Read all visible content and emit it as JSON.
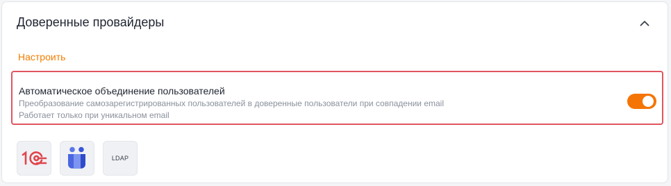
{
  "section": {
    "title": "Доверенные провайдеры",
    "collapse_icon": "chevron-up-icon"
  },
  "configure_link": "Настроить",
  "auto_merge": {
    "title": "Автоматическое объединение пользователей",
    "description_line1": "Преобразование самозарегистрированных пользователей в доверенные пользователи при совпадении email",
    "description_line2": "Работает только при уникальном email",
    "enabled": true,
    "accent_color": "#f47506"
  },
  "providers": [
    {
      "icon": "1c-logo-icon"
    },
    {
      "icon": "people-logo-icon"
    },
    {
      "icon": "ldap-icon",
      "label": "LDAP"
    }
  ]
}
